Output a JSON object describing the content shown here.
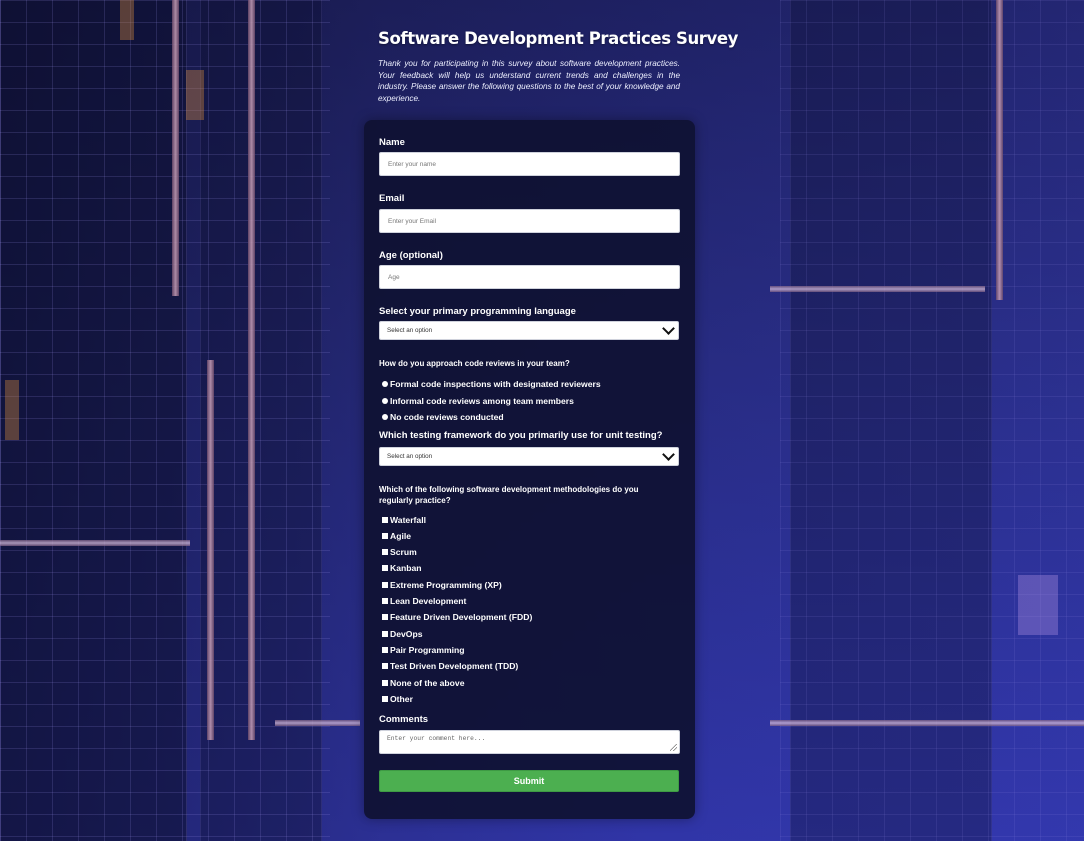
{
  "page": {
    "title": "Software Development Practices Survey",
    "intro": "Thank you for participating in this survey about software development practices. Your feedback will help us understand current trends and challenges in the industry. Please answer the following questions to the best of your knowledge and experience."
  },
  "form": {
    "name": {
      "label": "Name",
      "placeholder": "Enter your name"
    },
    "email": {
      "label": "Email",
      "placeholder": "Enter your Email"
    },
    "age": {
      "label": "Age (optional)",
      "placeholder": "Age"
    },
    "language": {
      "label": "Select your primary programming language",
      "selected": "Select an option"
    },
    "code_review": {
      "question": "How do you approach code reviews in your team?",
      "options": [
        "Formal code inspections with designated reviewers",
        "Informal code reviews among team members",
        "No code reviews conducted"
      ]
    },
    "testing": {
      "label": "Which testing framework do you primarily use for unit testing?",
      "selected": "Select an option"
    },
    "methodologies": {
      "question": "Which of the following software development methodologies do you regularly practice?",
      "options": [
        "Waterfall",
        "Agile",
        "Scrum",
        "Kanban",
        "Extreme Programming (XP)",
        "Lean Development",
        "Feature Driven Development (FDD)",
        "DevOps",
        "Pair Programming",
        "Test Driven Development (TDD)",
        "None of the above",
        "Other"
      ]
    },
    "comments": {
      "label": "Comments",
      "placeholder": "Enter your comment here..."
    },
    "submit_label": "Submit"
  },
  "icons": {
    "select_arrow": "chevron-down-icon",
    "radio": "radio-icon",
    "checkbox": "checkbox-icon",
    "resize": "resize-grip-icon"
  },
  "colors": {
    "card_bg": "#0f1132",
    "submit_bg": "#4caf50",
    "page_bg": "#2a2e86"
  }
}
